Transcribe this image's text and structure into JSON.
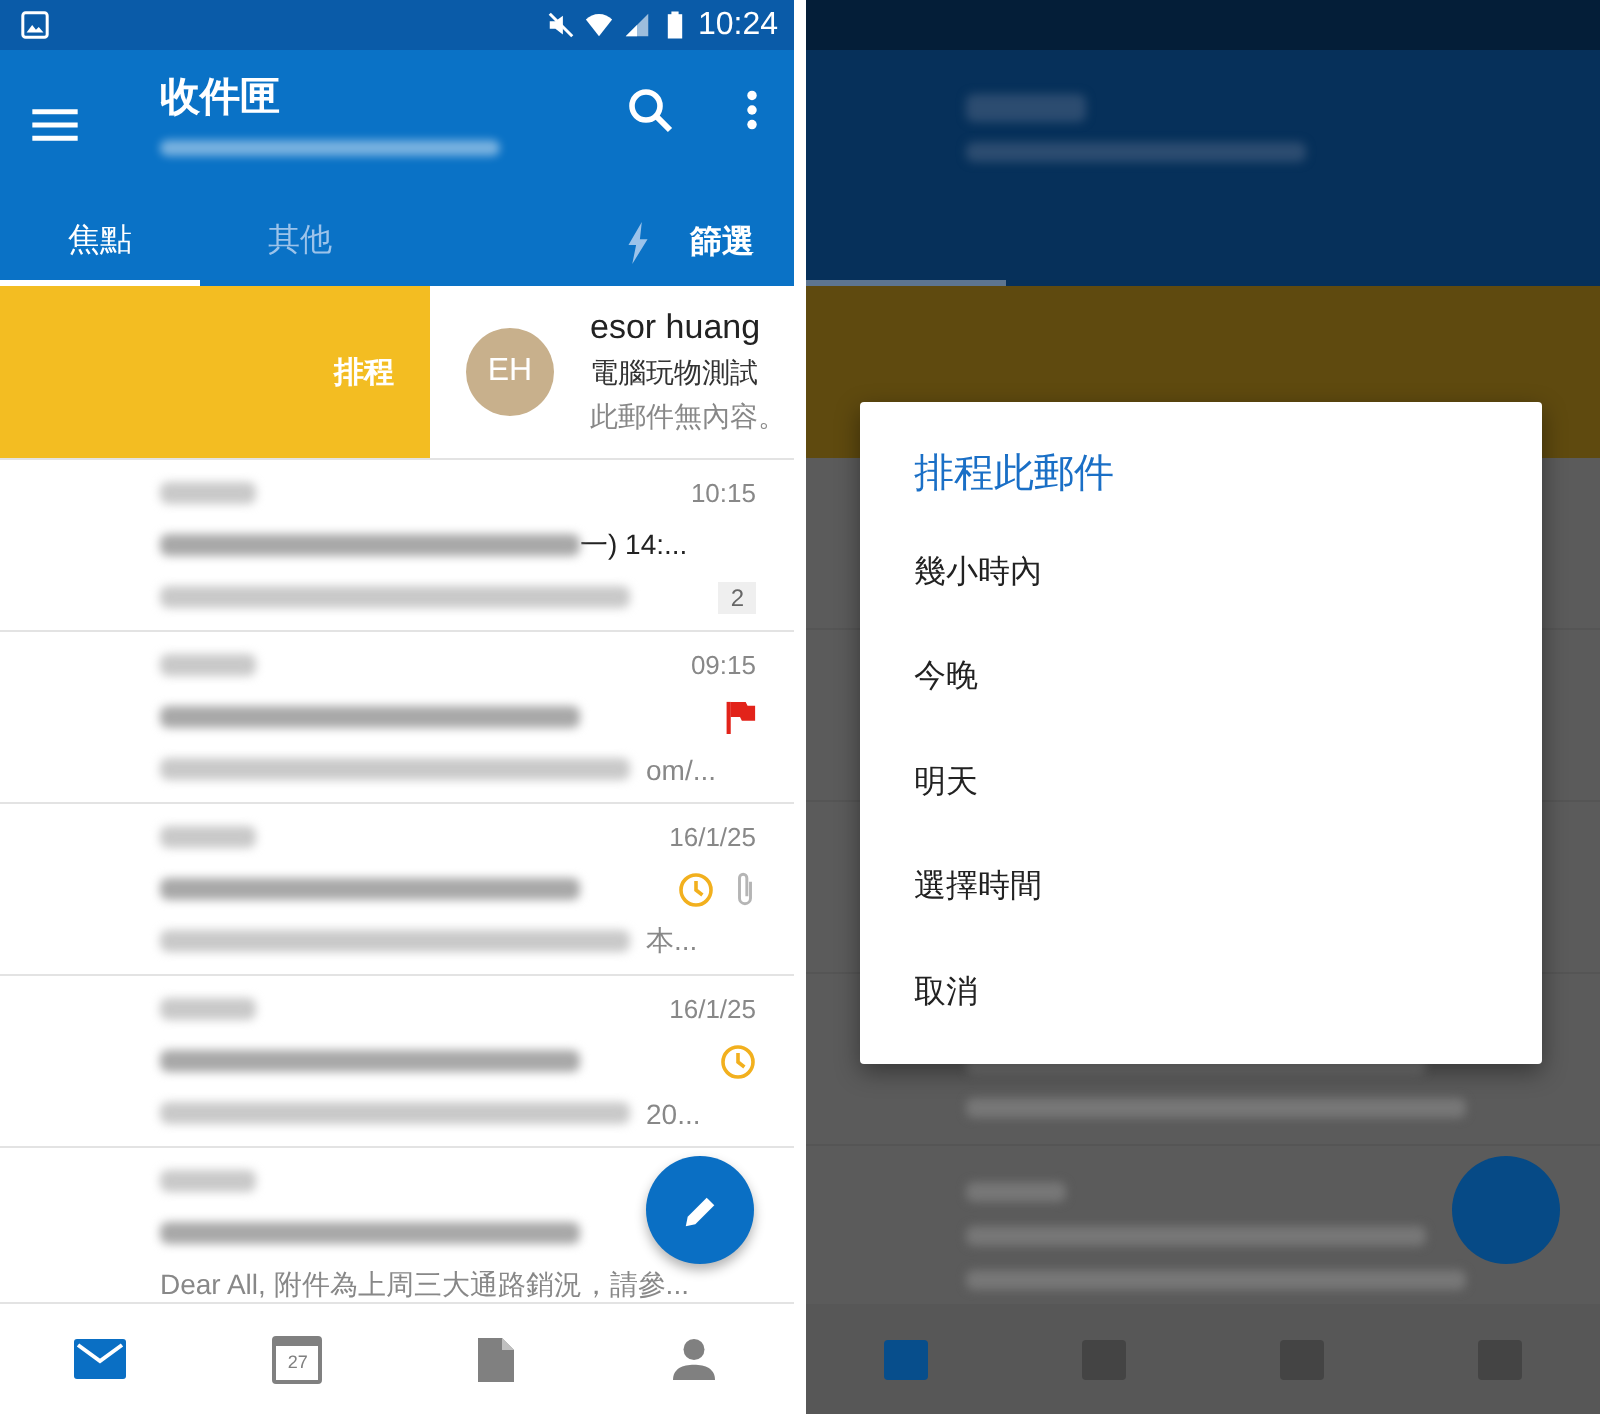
{
  "left_screen": {
    "status_bar": {
      "time": "10:24"
    },
    "app_bar": {
      "title": "收件匣"
    },
    "tabs": [
      {
        "label": "焦點",
        "selected": true
      },
      {
        "label": "其他",
        "selected": false
      }
    ],
    "filter_button": {
      "label": "篩選"
    },
    "swiped_message": {
      "action": "排程",
      "avatar": "EH",
      "sender": "esor huang",
      "subject": "電腦玩物測試",
      "preview": "此郵件無內容。"
    },
    "messages": [
      {
        "time": "10:15",
        "subject_tail": "一) 14:...",
        "count": "2",
        "flagged": false,
        "scheduled": false,
        "attachment": false
      },
      {
        "time": "09:15",
        "preview_tail": "om/...",
        "flagged": true,
        "scheduled": false,
        "attachment": false
      },
      {
        "time": "16/1/25",
        "preview_tail": "本...",
        "flagged": false,
        "scheduled": true,
        "attachment": true
      },
      {
        "time": "16/1/25",
        "preview_tail": "20...",
        "flagged": false,
        "scheduled": true,
        "attachment": false
      },
      {
        "preview": "Dear All, 附件為上周三大通路銷況，請參...",
        "flagged": false,
        "scheduled": false,
        "attachment": false
      }
    ],
    "bottom_nav": [
      {
        "kind": "mail",
        "selected": true
      },
      {
        "kind": "calendar",
        "label": "27",
        "selected": false
      },
      {
        "kind": "files",
        "selected": false
      },
      {
        "kind": "people",
        "selected": false
      }
    ]
  },
  "right_screen": {
    "dialog": {
      "title": "排程此郵件",
      "options": [
        "幾小時內",
        "今晚",
        "明天",
        "選擇時間",
        "取消"
      ]
    }
  }
}
